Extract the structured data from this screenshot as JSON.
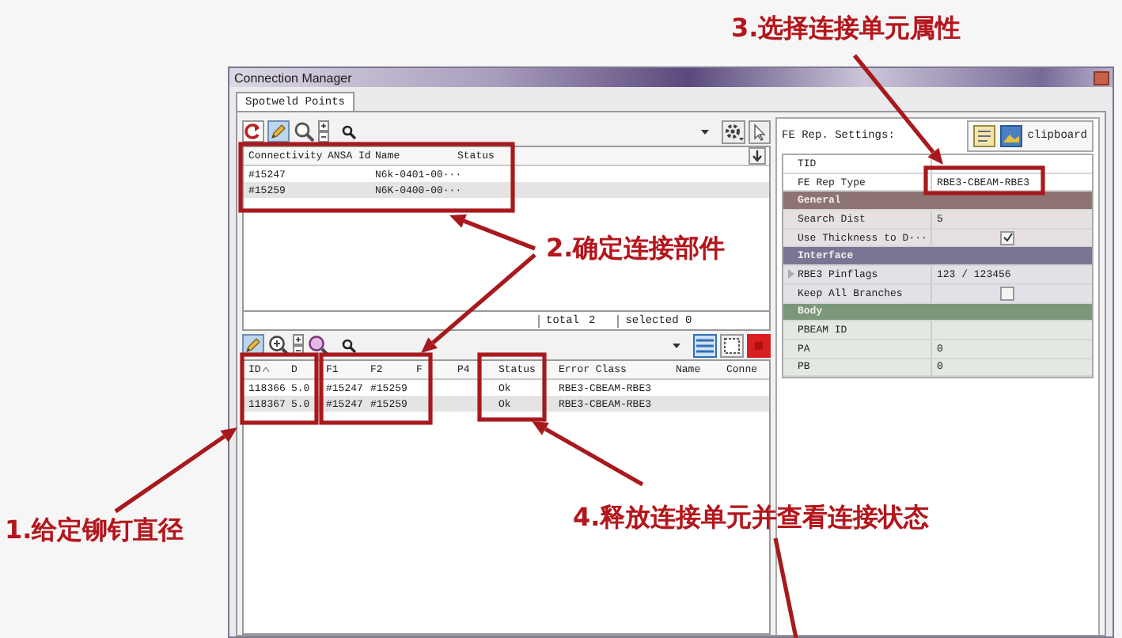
{
  "window": {
    "title": "Connection Manager"
  },
  "tabs": [
    {
      "label": "Spotweld Points",
      "selected": true
    }
  ],
  "parts_table": {
    "columns": [
      "Connectivity",
      "ANSA Id",
      "Name",
      "Status"
    ],
    "rows": [
      {
        "connectivity": "#15247",
        "name": "N6k-0401-00···"
      },
      {
        "connectivity": "#15259",
        "name": "N6K-0400-00···"
      }
    ],
    "total_label": "total",
    "total": "2",
    "selected_label": "selected 0"
  },
  "connections_table": {
    "columns": [
      "ID",
      "D",
      "F1",
      "F2",
      "F",
      "P4",
      "Status",
      "Error Class",
      "Name",
      "Conne"
    ],
    "rows": [
      {
        "id": "118366",
        "d": "5.0",
        "f1": "#15247",
        "f2": "#15259",
        "status": "Ok",
        "error_class": "RBE3-CBEAM-RBE3"
      },
      {
        "id": "118367",
        "d": "5.0",
        "f1": "#15247",
        "f2": "#15259",
        "status": "Ok",
        "error_class": "RBE3-CBEAM-RBE3"
      }
    ]
  },
  "fe_settings": {
    "title": "FE Rep. Settings:",
    "clipboard": "clipboard",
    "properties": [
      {
        "kind": "row",
        "label": "TID"
      },
      {
        "kind": "row",
        "label": "FE Rep Type",
        "value": "RBE3-CBEAM-RBE3"
      },
      {
        "kind": "section",
        "label": "General",
        "color": "#8e7373"
      },
      {
        "kind": "row",
        "label": "Search Dist",
        "value": "5"
      },
      {
        "kind": "check",
        "label": "Use Thickness to D···",
        "checked": true
      },
      {
        "kind": "section",
        "label": "Interface",
        "color": "#7b7594"
      },
      {
        "kind": "row",
        "label": "RBE3 Pinflags",
        "value": "123 / 123456",
        "expanded": false
      },
      {
        "kind": "check",
        "label": "Keep All Branches",
        "checked": false
      },
      {
        "kind": "section",
        "label": "Body",
        "color": "#7b9779"
      },
      {
        "kind": "row",
        "label": "PBEAM ID"
      },
      {
        "kind": "row",
        "label": "PA",
        "value": "0"
      },
      {
        "kind": "row",
        "label": "PB",
        "value": "0"
      }
    ]
  },
  "callouts": [
    "3.选择连接单元属性",
    "2.确定连接部件",
    "1.给定铆钉直径",
    "4.释放连接单元并查看连接状态"
  ]
}
